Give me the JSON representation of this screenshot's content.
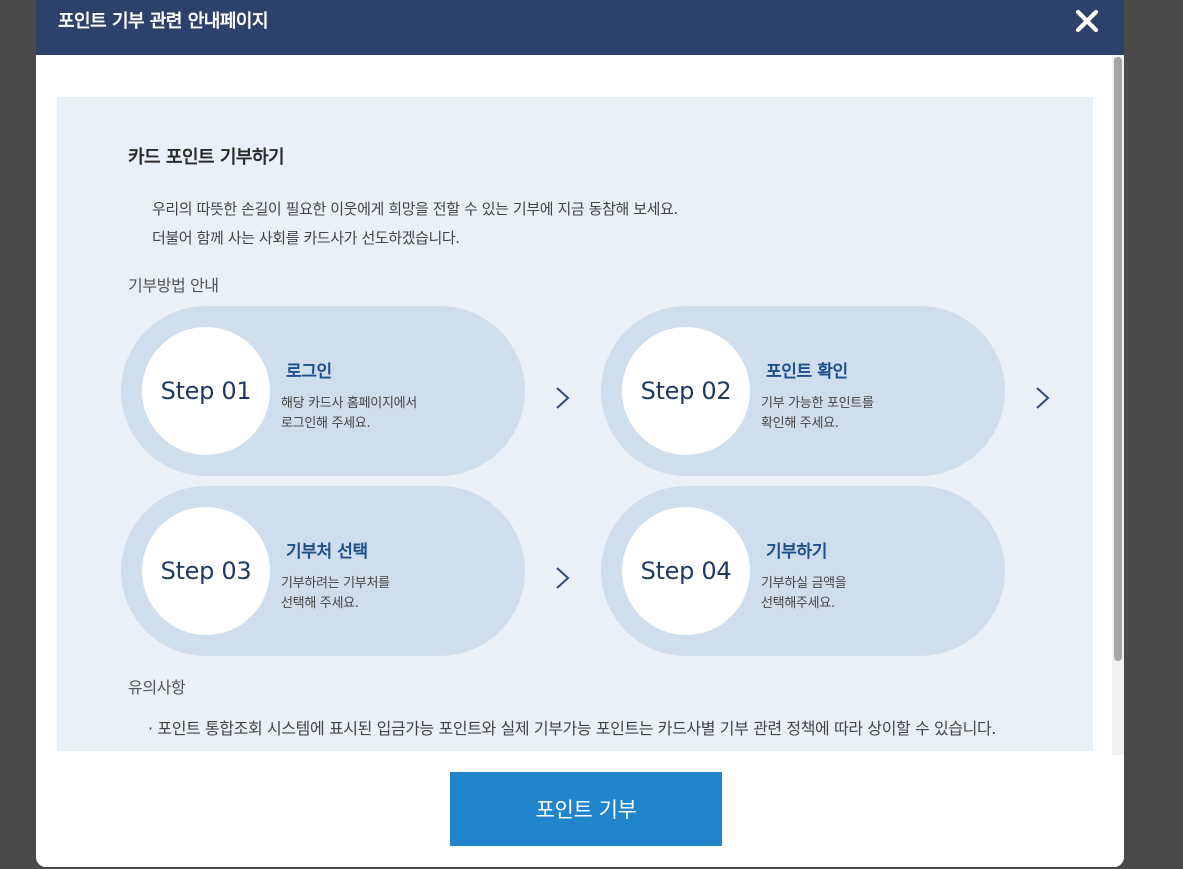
{
  "modal": {
    "title": "포인트 기부 관련 안내페이지",
    "close_icon": "close-icon"
  },
  "content": {
    "section_title": "카드 포인트 기부하기",
    "intro_line1": "우리의 따뜻한 손길이 필요한 이웃에게 희망을 전할 수 있는 기부에 지금 동참해 보세요.",
    "intro_line2": "더불어 함께 사는 사회를 카드사가 선도하겠습니다.",
    "guide_title": "기부방법 안내",
    "steps": [
      {
        "label": "Step 01",
        "title": "로그인",
        "desc": "해당 카드사 홈페이지에서\n로그인해 주세요."
      },
      {
        "label": "Step 02",
        "title": "포인트 확인",
        "desc": "기부 가능한 포인트를\n확인해 주세요."
      },
      {
        "label": "Step 03",
        "title": "기부처 선택",
        "desc": "기부하려는 기부처를\n선택해 주세요."
      },
      {
        "label": "Step 04",
        "title": "기부하기",
        "desc": "기부하실 금액을\n선택해주세요."
      }
    ],
    "notes_title": "유의사항",
    "notes": [
      "· 포인트 통합조회 시스템에 표시된 입금가능 포인트와 실제 기부가능 포인트는 카드사별 기부 관련 정책에 따라 상이할 수 있습니다."
    ]
  },
  "footer": {
    "donate_button": "포인트 기부"
  },
  "colors": {
    "header_bg": "#2e416b",
    "content_bg": "#eaf0f8",
    "step_bg": "#cfdeed",
    "button_bg": "#2185cc",
    "step_title": "#1f4f8b"
  }
}
